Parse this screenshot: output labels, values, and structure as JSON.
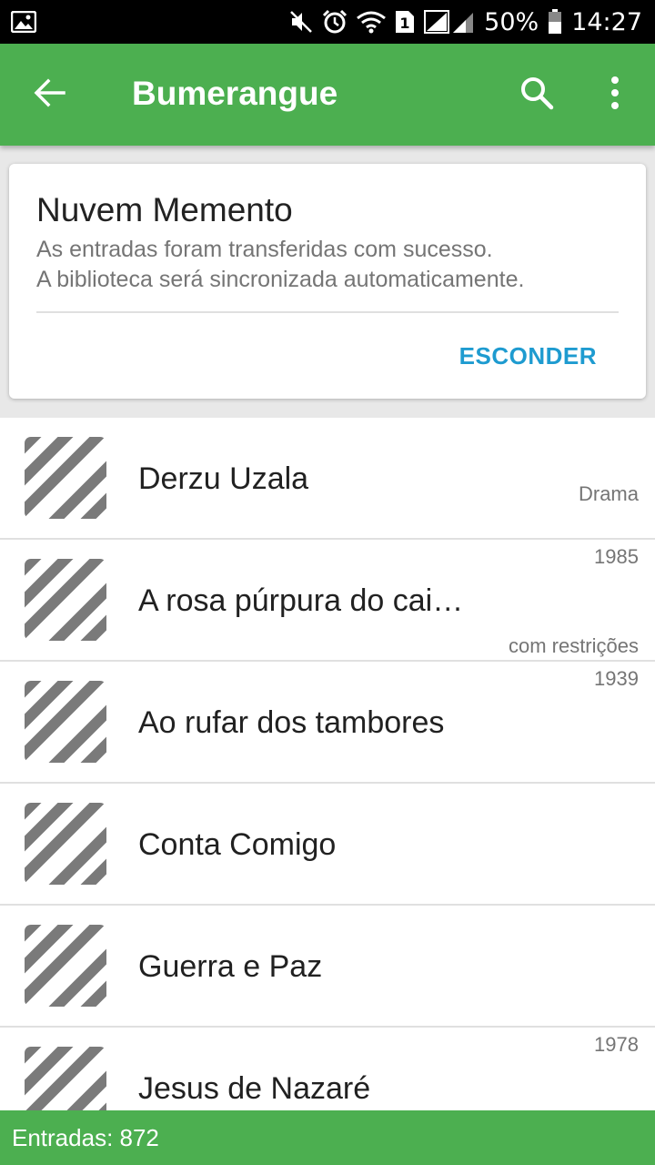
{
  "status_bar": {
    "battery": "50%",
    "time": "14:27",
    "sim_slot": "1",
    "icons": [
      "image-notification-icon",
      "mute-icon",
      "alarm-icon",
      "wifi-icon",
      "sim-icon",
      "signal-icon",
      "battery-icon"
    ]
  },
  "app_bar": {
    "title": "Bumerangue",
    "color": "#4caf50",
    "icons": [
      "back-arrow-icon",
      "search-icon",
      "more-vert-icon"
    ]
  },
  "card": {
    "title": "Nuvem Memento",
    "line1": "As entradas foram transferidas com sucesso.",
    "line2": "A biblioteca será sincronizada automaticamente.",
    "action": "ESCONDER",
    "action_color": "#1e9bd0"
  },
  "list": {
    "items": [
      {
        "title": "Derzu Uzala",
        "top_meta": "",
        "bottom_meta": "Drama"
      },
      {
        "title": "A rosa púrpura do cai…",
        "top_meta": "1985",
        "bottom_meta": "com restrições"
      },
      {
        "title": "Ao rufar dos tambores",
        "top_meta": "1939",
        "bottom_meta": ""
      },
      {
        "title": "Conta Comigo",
        "top_meta": "",
        "bottom_meta": ""
      },
      {
        "title": "Guerra e Paz",
        "top_meta": "",
        "bottom_meta": ""
      },
      {
        "title": "Jesus de Nazaré",
        "top_meta": "1978",
        "bottom_meta": ""
      }
    ],
    "thumb_icon": "striped-placeholder-icon"
  },
  "footer": {
    "text": "Entradas: 872"
  }
}
